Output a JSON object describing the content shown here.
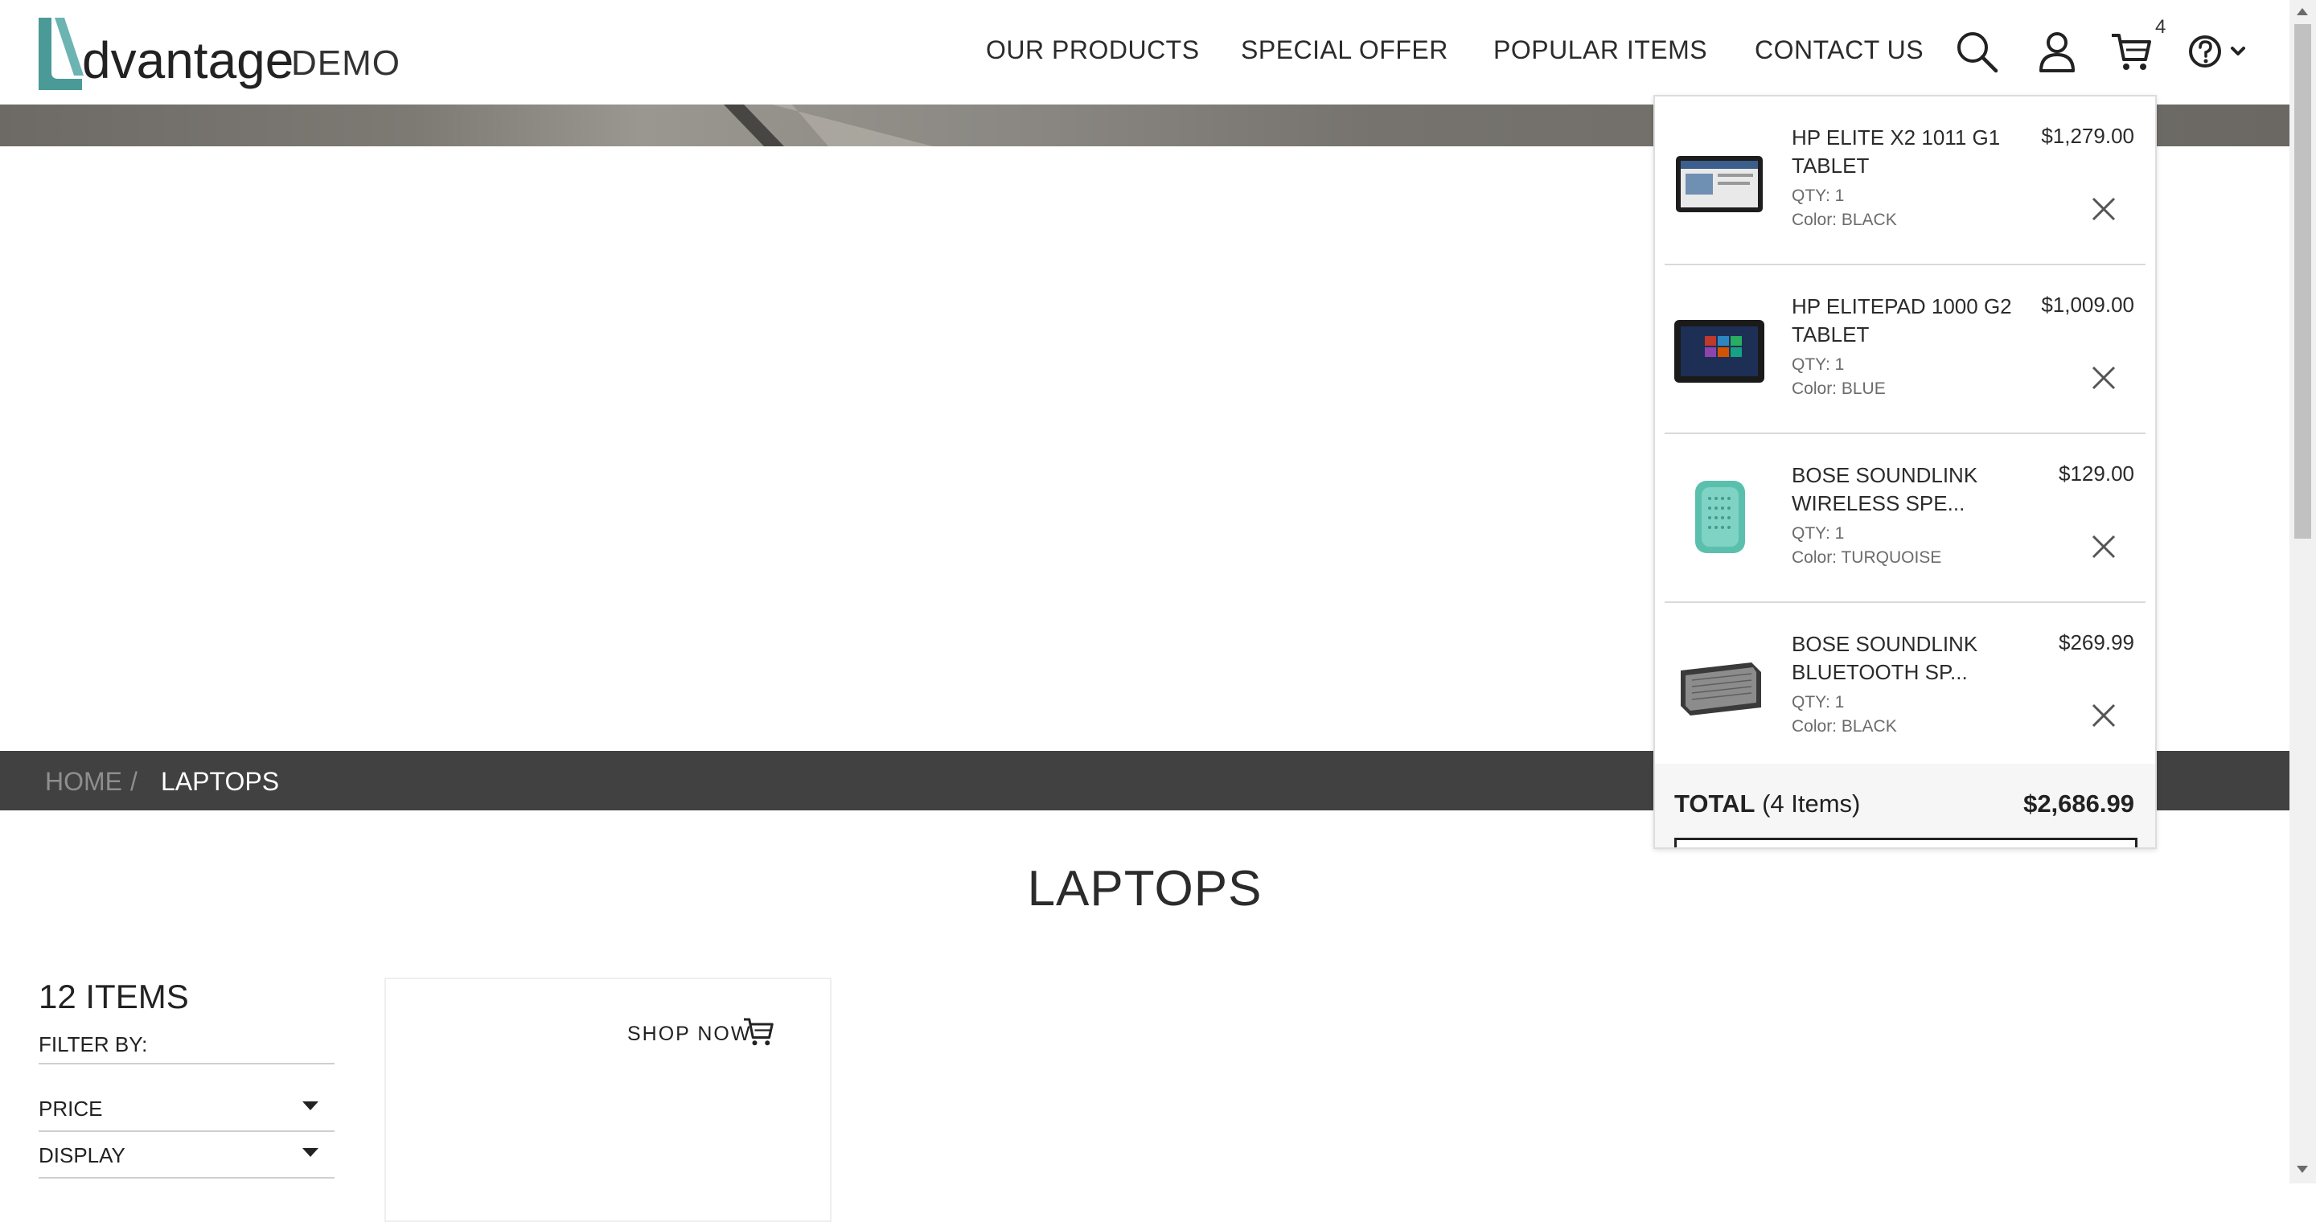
{
  "logo": {
    "word": "dvantage",
    "suffix": "DEMO"
  },
  "nav": {
    "items": [
      "OUR PRODUCTS",
      "SPECIAL OFFER",
      "POPULAR ITEMS",
      "CONTACT US"
    ]
  },
  "header_icons": {
    "search": "search-icon",
    "user": "user-icon",
    "cart": "cart-icon",
    "help": "help-icon",
    "cart_count": "4"
  },
  "breadcrumb": {
    "home": "HOME",
    "separator": "/",
    "current": "LAPTOPS"
  },
  "page": {
    "title": "LAPTOPS"
  },
  "filter": {
    "items_count": "12 ITEMS",
    "filter_by": "FILTER BY:",
    "options": [
      "PRICE",
      "DISPLAY"
    ]
  },
  "product_card": {
    "shop_now": "SHOP NOW"
  },
  "cart": {
    "items": [
      {
        "name": "HP ELITE X2 1011 G1 TABLET",
        "price": "$1,279.00",
        "qty": "QTY: 1",
        "color": "Color: BLACK"
      },
      {
        "name": "HP ELITEPAD 1000 G2 TABLET",
        "price": "$1,009.00",
        "qty": "QTY: 1",
        "color": "Color: BLUE"
      },
      {
        "name": "BOSE SOUNDLINK WIRELESS SPE...",
        "price": "$129.00",
        "qty": "QTY: 1",
        "color": "Color: TURQUOISE"
      },
      {
        "name": "BOSE SOUNDLINK BLUETOOTH SP...",
        "price": "$269.99",
        "qty": "QTY: 1",
        "color": "Color: BLACK"
      }
    ],
    "total_label": "TOTAL",
    "total_count": "(4 Items)",
    "total_amount": "$2,686.99"
  },
  "colors": {
    "brand_teal": "#4a9a98",
    "breadcrumb_bg": "#414141"
  }
}
